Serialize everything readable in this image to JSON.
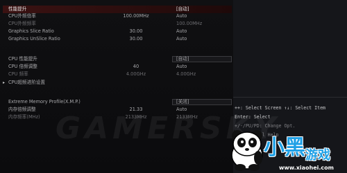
{
  "rows": [
    {
      "label": "性能提升",
      "value": "[自动]",
      "selected": true,
      "boxed": true
    },
    {
      "label": "CPU外频倍率",
      "number": "100.00MHz",
      "value": "Auto"
    },
    {
      "label": "CPU外频频率",
      "number": "",
      "value": "100.00MHz",
      "dim": true
    },
    {
      "label": "Graphics Slice Ratio",
      "number": "30.00",
      "value": "Auto"
    },
    {
      "label": "Graphics UnSlice Ratio",
      "number": "30.00",
      "value": "Auto"
    },
    {
      "label": "CPU 性能提升",
      "number": "",
      "value": "[自动]",
      "boxed": true
    },
    {
      "label": "CPU 倍频调整",
      "number": "40",
      "value": "Auto"
    },
    {
      "label": "CPU 频率",
      "number": "4.00GHz",
      "value": "4.00GHz",
      "dim": true
    },
    {
      "label": "CPU超频进阶设置",
      "arrow": true
    },
    {
      "label": "Extreme Memory Profile(X.M.P.)",
      "value": "[关闭]",
      "boxed": true
    },
    {
      "label": "内存倍频调整",
      "number": "21.33",
      "value": "Auto"
    },
    {
      "label": "内存频率(MHz)",
      "number": "2133MHz",
      "value": "2133MHz",
      "dim": true
    }
  ],
  "help": {
    "line1": "++: Select Screen  ↑↓: Select Item",
    "line2": "Enter: Select",
    "line3": "+/-/PU/PD: Change Opt.",
    "line4": "F1: General Help"
  },
  "watermark": "GAMERSKY",
  "logo": {
    "cn1": "小黑",
    "cn2": "游戏",
    "url": "www.xiaohei.com"
  }
}
